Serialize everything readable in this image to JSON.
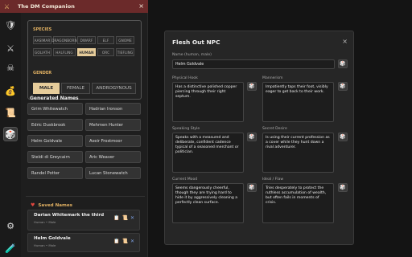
{
  "app": {
    "title": "The DM Companion",
    "close": "×"
  },
  "rail": {
    "icons": [
      {
        "name": "shield-icon",
        "glyph": "🛡"
      },
      {
        "name": "crossed-swords-icon",
        "glyph": "⚔"
      },
      {
        "name": "skull-icon",
        "glyph": "☠"
      },
      {
        "name": "money-bag-icon",
        "glyph": "💰"
      },
      {
        "name": "scroll-icon",
        "glyph": "📜"
      },
      {
        "name": "dice-icon",
        "glyph": "🎲"
      },
      {
        "name": "gear-icon",
        "glyph": "⚙"
      },
      {
        "name": "potion-icon",
        "glyph": "🧪"
      }
    ]
  },
  "filters": {
    "species_label": "SPECIES",
    "species": [
      "AASIMAR",
      "DRAGONBORN",
      "DWARF",
      "ELF",
      "GNOME",
      "GOLIATH",
      "HALFLING",
      "HUMAN",
      "ORC",
      "TIEFLING"
    ],
    "selected_species": "HUMAN",
    "gender_label": "GENDER",
    "genders": [
      "MALE",
      "FEMALE",
      "ANDROGYNOUS"
    ],
    "selected_gender": "MALE"
  },
  "generated": {
    "heading": "Generated Names",
    "names": [
      "Grim Whitewatch",
      "Hadrian Ironson",
      "Edric Duskbrook",
      "Mehmen Hunter",
      "Helm Goldvale",
      "Aseir Frostmoor",
      "Steldi di Greycairn",
      "Aric Weaver",
      "Randel Potter",
      "Lucan Stonewatch"
    ]
  },
  "saved": {
    "heading": "Saved Names",
    "items": [
      {
        "name": "Darian Whitemark the third",
        "sub": "Human • Male"
      },
      {
        "name": "Helm Goldvale",
        "sub": "Human • Male"
      }
    ]
  },
  "modal": {
    "title": "Flesh Out NPC",
    "close": "×",
    "name_label": "Name (human, male)",
    "name_value": "Helm Goldvale",
    "physical_hook_label": "Physical Hook",
    "physical_hook": "Has a distinctive polished copper piercing through their right septum.",
    "mannerism_label": "Mannerism",
    "mannerism": "Impatiently taps their foot, visibly eager to get back to their work.",
    "speaking_style_label": "Speaking Style",
    "speaking_style": "Speaks with a measured and deliberate, confident cadence typical of a seasoned merchant or politician.",
    "secret_desire_label": "Secret Desire",
    "secret_desire": "Is using their current profession as a cover while they hunt down a rival adventurer.",
    "current_mood_label": "Current Mood",
    "current_mood": "Seems dangerously cheerful, though they are trying hard to hide it by aggressively cleaning a perfectly clean surface.",
    "ideal_flaw_label": "Ideal / Flaw",
    "ideal_flaw": "Tries desperately to protect the ruthless accumulation of wealth, but often fails in moments of crisis."
  },
  "colors": {
    "accent": "#e0b062",
    "titlebar": "#6b2a2a",
    "selected_chip": "#e6cc9a"
  }
}
